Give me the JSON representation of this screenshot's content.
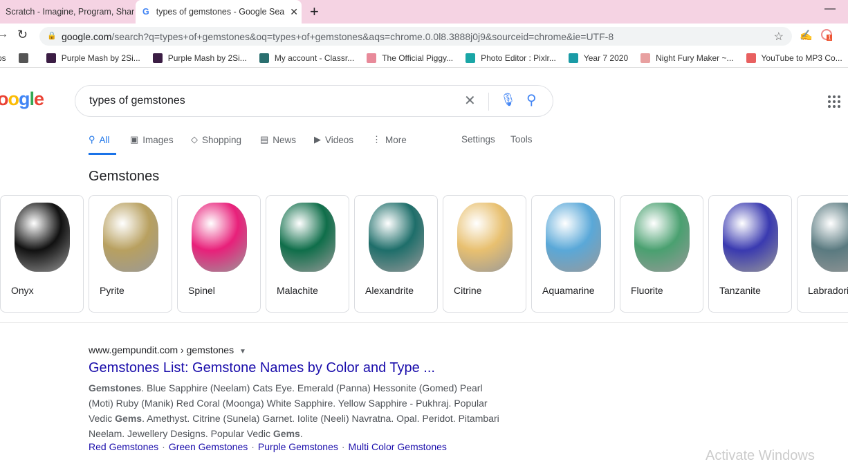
{
  "tabs": [
    {
      "title": "Scratch - Imagine, Program, Shar"
    },
    {
      "title": "types of gemstones - Google Sea"
    }
  ],
  "address": {
    "host": "google.com",
    "path": "/search?q=types+of+gemstones&oq=types+of+gemstones&aqs=chrome.0.0l8.3888j0j9&sourceid=chrome&ie=UTF-8"
  },
  "extension_badge": "1",
  "bookmarks": [
    {
      "label": "ps",
      "color": "#fff"
    },
    {
      "label": "",
      "color": "#555"
    },
    {
      "label": "Purple Mash by 2Si...",
      "color": "#3b1d44"
    },
    {
      "label": "Purple Mash by 2Si...",
      "color": "#3b1d44"
    },
    {
      "label": "My account - Classr...",
      "color": "#2a6f6f"
    },
    {
      "label": "The Official Piggy...",
      "color": "#e88a9a"
    },
    {
      "label": "Photo Editor : Pixlr...",
      "color": "#1aa6a6"
    },
    {
      "label": "Year 7 2020",
      "color": "#1a9ba6"
    },
    {
      "label": "Night Fury Maker ~...",
      "color": "#e8a0a0"
    },
    {
      "label": "YouTube to MP3 Co...",
      "color": "#e86060"
    }
  ],
  "search": {
    "query": "types of gemstones",
    "logo": "oogle"
  },
  "nav": {
    "tabs": [
      {
        "label": "All",
        "icon": "search-icon"
      },
      {
        "label": "Images",
        "icon": "image-icon"
      },
      {
        "label": "Shopping",
        "icon": "tag-icon"
      },
      {
        "label": "News",
        "icon": "news-icon"
      },
      {
        "label": "Videos",
        "icon": "play-icon"
      },
      {
        "label": "More",
        "icon": "more-vert-icon"
      }
    ],
    "settings": "Settings",
    "tools": "Tools"
  },
  "gemstones": {
    "title": "Gemstones",
    "items": [
      {
        "name": "Onyx",
        "color": "#111111"
      },
      {
        "name": "Pyrite",
        "color": "#b8a060"
      },
      {
        "name": "Spinel",
        "color": "#e8207a"
      },
      {
        "name": "Malachite",
        "color": "#0f6e4a"
      },
      {
        "name": "Alexandrite",
        "color": "#1e6e6a"
      },
      {
        "name": "Citrine",
        "color": "#e8c070"
      },
      {
        "name": "Aquamarine",
        "color": "#5aa8d8"
      },
      {
        "name": "Fluorite",
        "color": "#4aa070"
      },
      {
        "name": "Tanzanite",
        "color": "#3a3ab0"
      },
      {
        "name": "Labradorite",
        "color": "#5a7a80"
      }
    ]
  },
  "result": {
    "cite": "www.gempundit.com › gemstones",
    "title": "Gemstones List: Gemstone Names by Color and Type ...",
    "snippet": [
      {
        "t": "Gemstones",
        "b": true
      },
      {
        "t": ". Blue Sapphire (Neelam) Cats Eye. Emerald (Panna) Hessonite (Gomed) Pearl (Moti) Ruby (Manik) Red Coral (Moonga) White Sapphire. Yellow Sapphire - Pukhraj. Popular Vedic "
      },
      {
        "t": "Gems",
        "b": true
      },
      {
        "t": ". Amethyst. Citrine (Sunela) Garnet. Iolite (Neeli) Navratna. Opal. Peridot. Pitambari Neelam. Jewellery Designs. Popular Vedic "
      },
      {
        "t": "Gems",
        "b": true
      },
      {
        "t": "."
      }
    ],
    "sitelinks": [
      "Red Gemstones",
      "Green Gemstones",
      "Purple Gemstones",
      "Multi Color Gemstones"
    ]
  },
  "watermark": "Activate Windows"
}
